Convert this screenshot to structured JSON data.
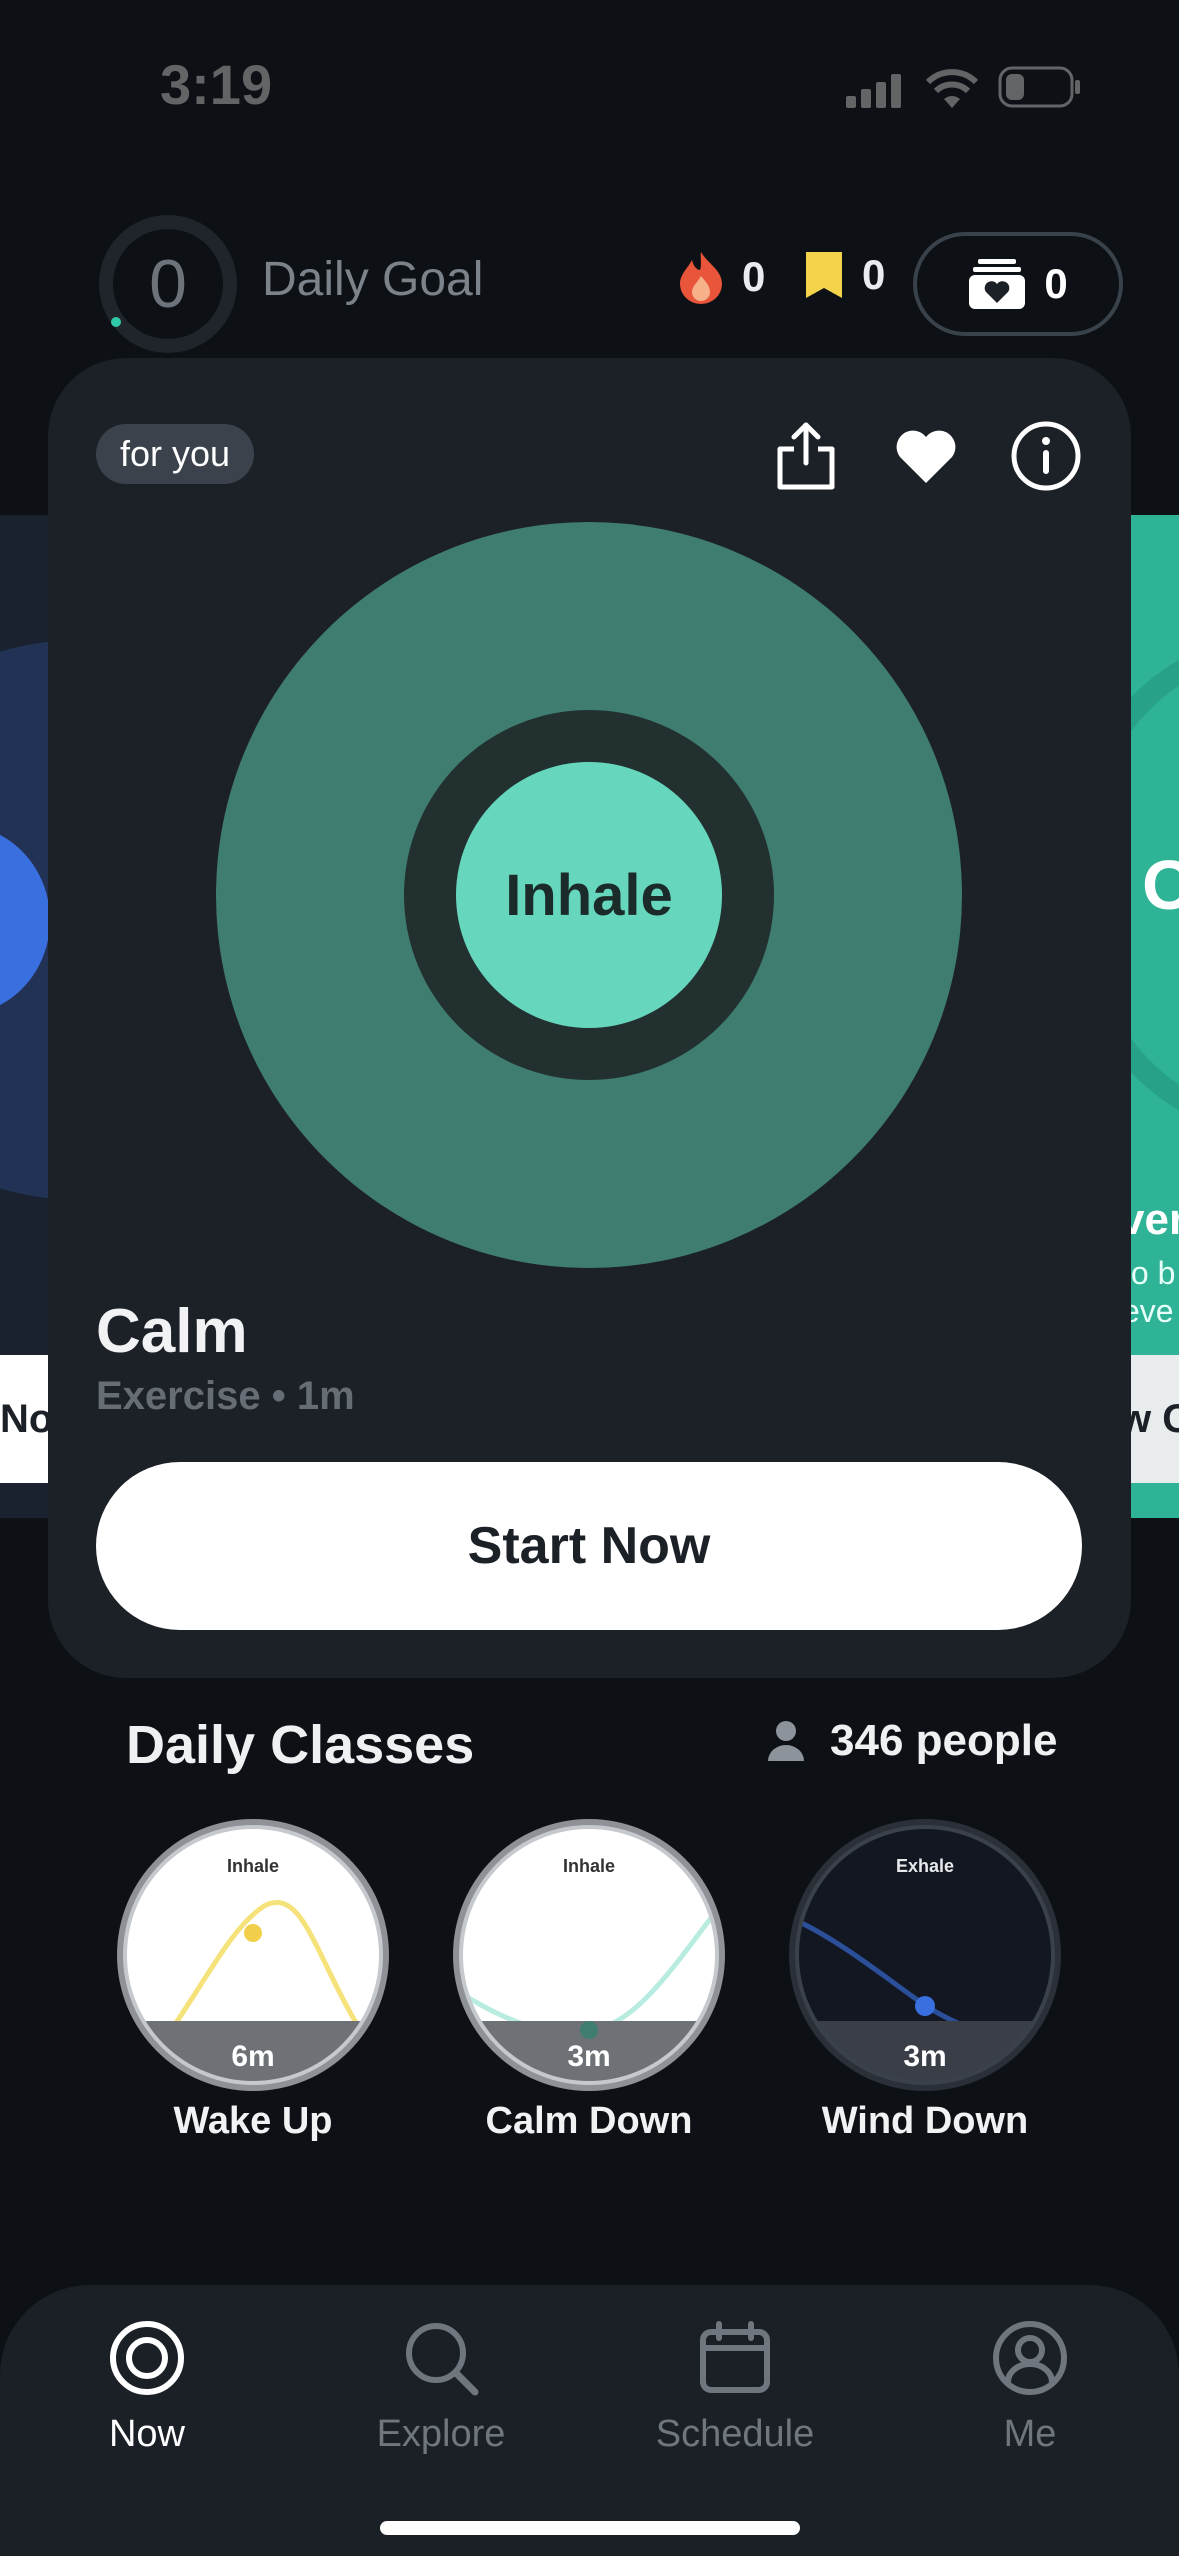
{
  "status_bar": {
    "time": "3:19"
  },
  "header": {
    "goal_value": "0",
    "goal_label": "Daily Goal",
    "streak_count": "0",
    "badge_count": "0",
    "saved_count": "0"
  },
  "card": {
    "tag": "for you",
    "breath_label": "Inhale",
    "title": "Calm",
    "subtitle": "Exercise • 1m",
    "start_label": "Start Now"
  },
  "side_cards": {
    "left_button_fragment": "Nov",
    "right_big_fragment": "O",
    "right_title_fragment": "ver",
    "right_line1_fragment": "to b",
    "right_line2_fragment": "eve",
    "right_button_fragment": "w C"
  },
  "daily_classes": {
    "title": "Daily Classes",
    "people": "346 people",
    "items": [
      {
        "phase": "Inhale",
        "duration": "6m",
        "label": "Wake Up"
      },
      {
        "phase": "Inhale",
        "duration": "3m",
        "label": "Calm Down"
      },
      {
        "phase": "Exhale",
        "duration": "3m",
        "label": "Wind Down"
      }
    ]
  },
  "tabs": [
    {
      "label": "Now",
      "icon": "target-icon",
      "active": true
    },
    {
      "label": "Explore",
      "icon": "search-icon",
      "active": false
    },
    {
      "label": "Schedule",
      "icon": "calendar-icon",
      "active": false
    },
    {
      "label": "Me",
      "icon": "profile-icon",
      "active": false
    }
  ],
  "colors": {
    "background": "#0d1014",
    "card": "#1c2027",
    "breath_outer": "#3f7d70",
    "breath_core": "#66d6bd",
    "accent_yellow": "#f2cf4a",
    "accent_teal": "#6fd8c1",
    "accent_blue": "#3a6fe0"
  }
}
